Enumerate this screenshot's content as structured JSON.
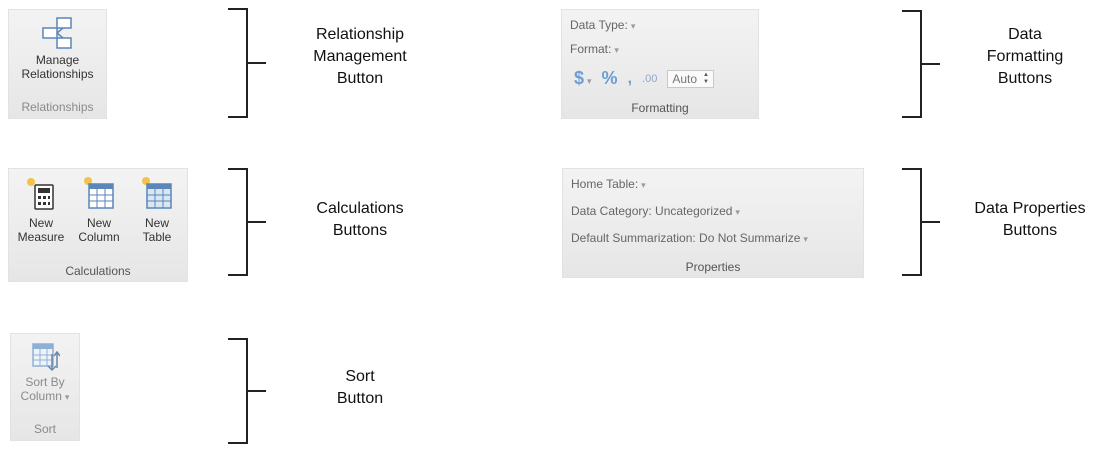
{
  "relationships": {
    "button_label_line1": "Manage",
    "button_label_line2": "Relationships",
    "group_label": "Relationships",
    "caption_line1": "Relationship",
    "caption_line2": "Management",
    "caption_line3": "Button"
  },
  "calculations": {
    "measure_line1": "New",
    "measure_line2": "Measure",
    "column_line1": "New",
    "column_line2": "Column",
    "table_line1": "New",
    "table_line2": "Table",
    "group_label": "Calculations",
    "caption_line1": "Calculations",
    "caption_line2": "Buttons"
  },
  "sort": {
    "button_line1": "Sort By",
    "button_line2": "Column",
    "group_label": "Sort",
    "caption_line1": "Sort",
    "caption_line2": "Button"
  },
  "formatting": {
    "data_type_label": "Data Type:",
    "format_label": "Format:",
    "currency_symbol": "$",
    "percent_symbol": "%",
    "comma_symbol": ",",
    "decimal_symbol": ".00",
    "auto_value": "Auto",
    "group_label": "Formatting",
    "caption_line1": "Data",
    "caption_line2": "Formatting",
    "caption_line3": "Buttons"
  },
  "properties": {
    "home_table_label": "Home Table:",
    "data_category_label": "Data Category: Uncategorized",
    "default_summarization_label": "Default Summarization: Do Not Summarize",
    "group_label": "Properties",
    "caption_line1": "Data Properties",
    "caption_line2": "Buttons"
  },
  "icons": {
    "dropdown_glyph": "▾",
    "spinner_up": "▲",
    "spinner_down": "▼"
  },
  "colors": {
    "ribbon_bg": "#ececec",
    "accent_blue": "#6b9ed6",
    "icon_sun": "#f2c24a"
  }
}
